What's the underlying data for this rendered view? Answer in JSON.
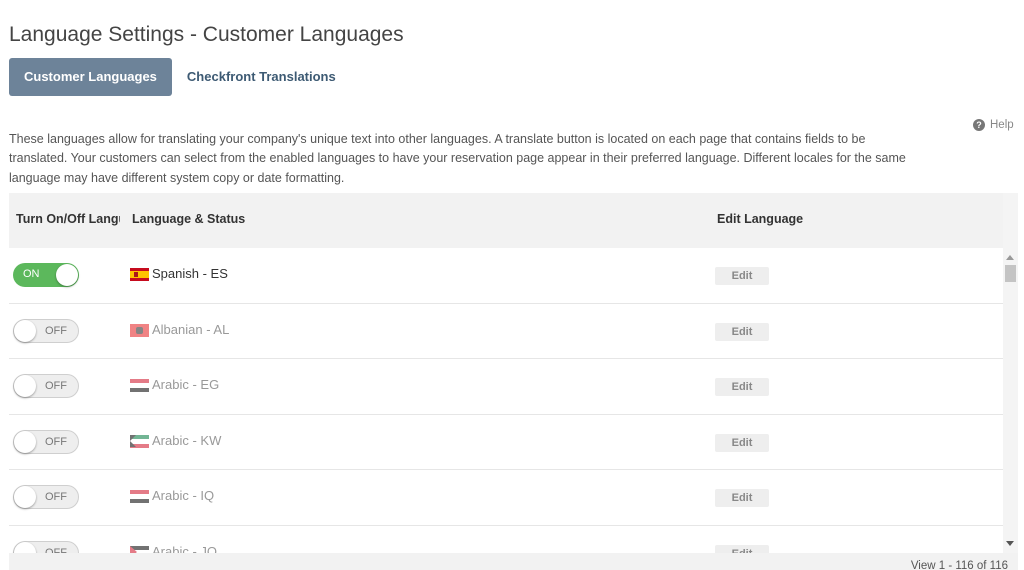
{
  "page": {
    "title": "Language Settings - Customer Languages"
  },
  "tabs": [
    {
      "label": "Customer Languages",
      "active": true
    },
    {
      "label": "Checkfront Translations",
      "active": false
    }
  ],
  "description": "These languages allow for translating your company's unique text into other languages. A translate button is located on each page that contains fields to be translated. Your customers can select from the enabled languages to have your reservation page appear in their preferred language. Different locales for the same language may have different system copy or date formatting.",
  "help": {
    "label": "Help",
    "icon": "question-circle-icon"
  },
  "grid": {
    "columns": [
      "Turn On/Off Language",
      "Language & Status",
      "Edit Language"
    ],
    "rows": [
      {
        "toggle": "ON",
        "enabled": true,
        "flag": "spain-flag-icon",
        "language": "Spanish - ES",
        "edit": "Edit"
      },
      {
        "toggle": "OFF",
        "enabled": false,
        "flag": "albania-flag-icon",
        "language": "Albanian - AL",
        "edit": "Edit"
      },
      {
        "toggle": "OFF",
        "enabled": false,
        "flag": "egypt-flag-icon",
        "language": "Arabic - EG",
        "edit": "Edit"
      },
      {
        "toggle": "OFF",
        "enabled": false,
        "flag": "kuwait-flag-icon",
        "language": "Arabic - KW",
        "edit": "Edit"
      },
      {
        "toggle": "OFF",
        "enabled": false,
        "flag": "iraq-flag-icon",
        "language": "Arabic - IQ",
        "edit": "Edit"
      },
      {
        "toggle": "OFF",
        "enabled": false,
        "flag": "jordan-flag-icon",
        "language": "Arabic - JO",
        "edit": "Edit"
      }
    ],
    "pager": "View 1 - 116 of 116"
  },
  "colors": {
    "toggle_on": "#5cb85c",
    "tab_active": "#6d8399",
    "tab_text": "#3d5a73"
  }
}
